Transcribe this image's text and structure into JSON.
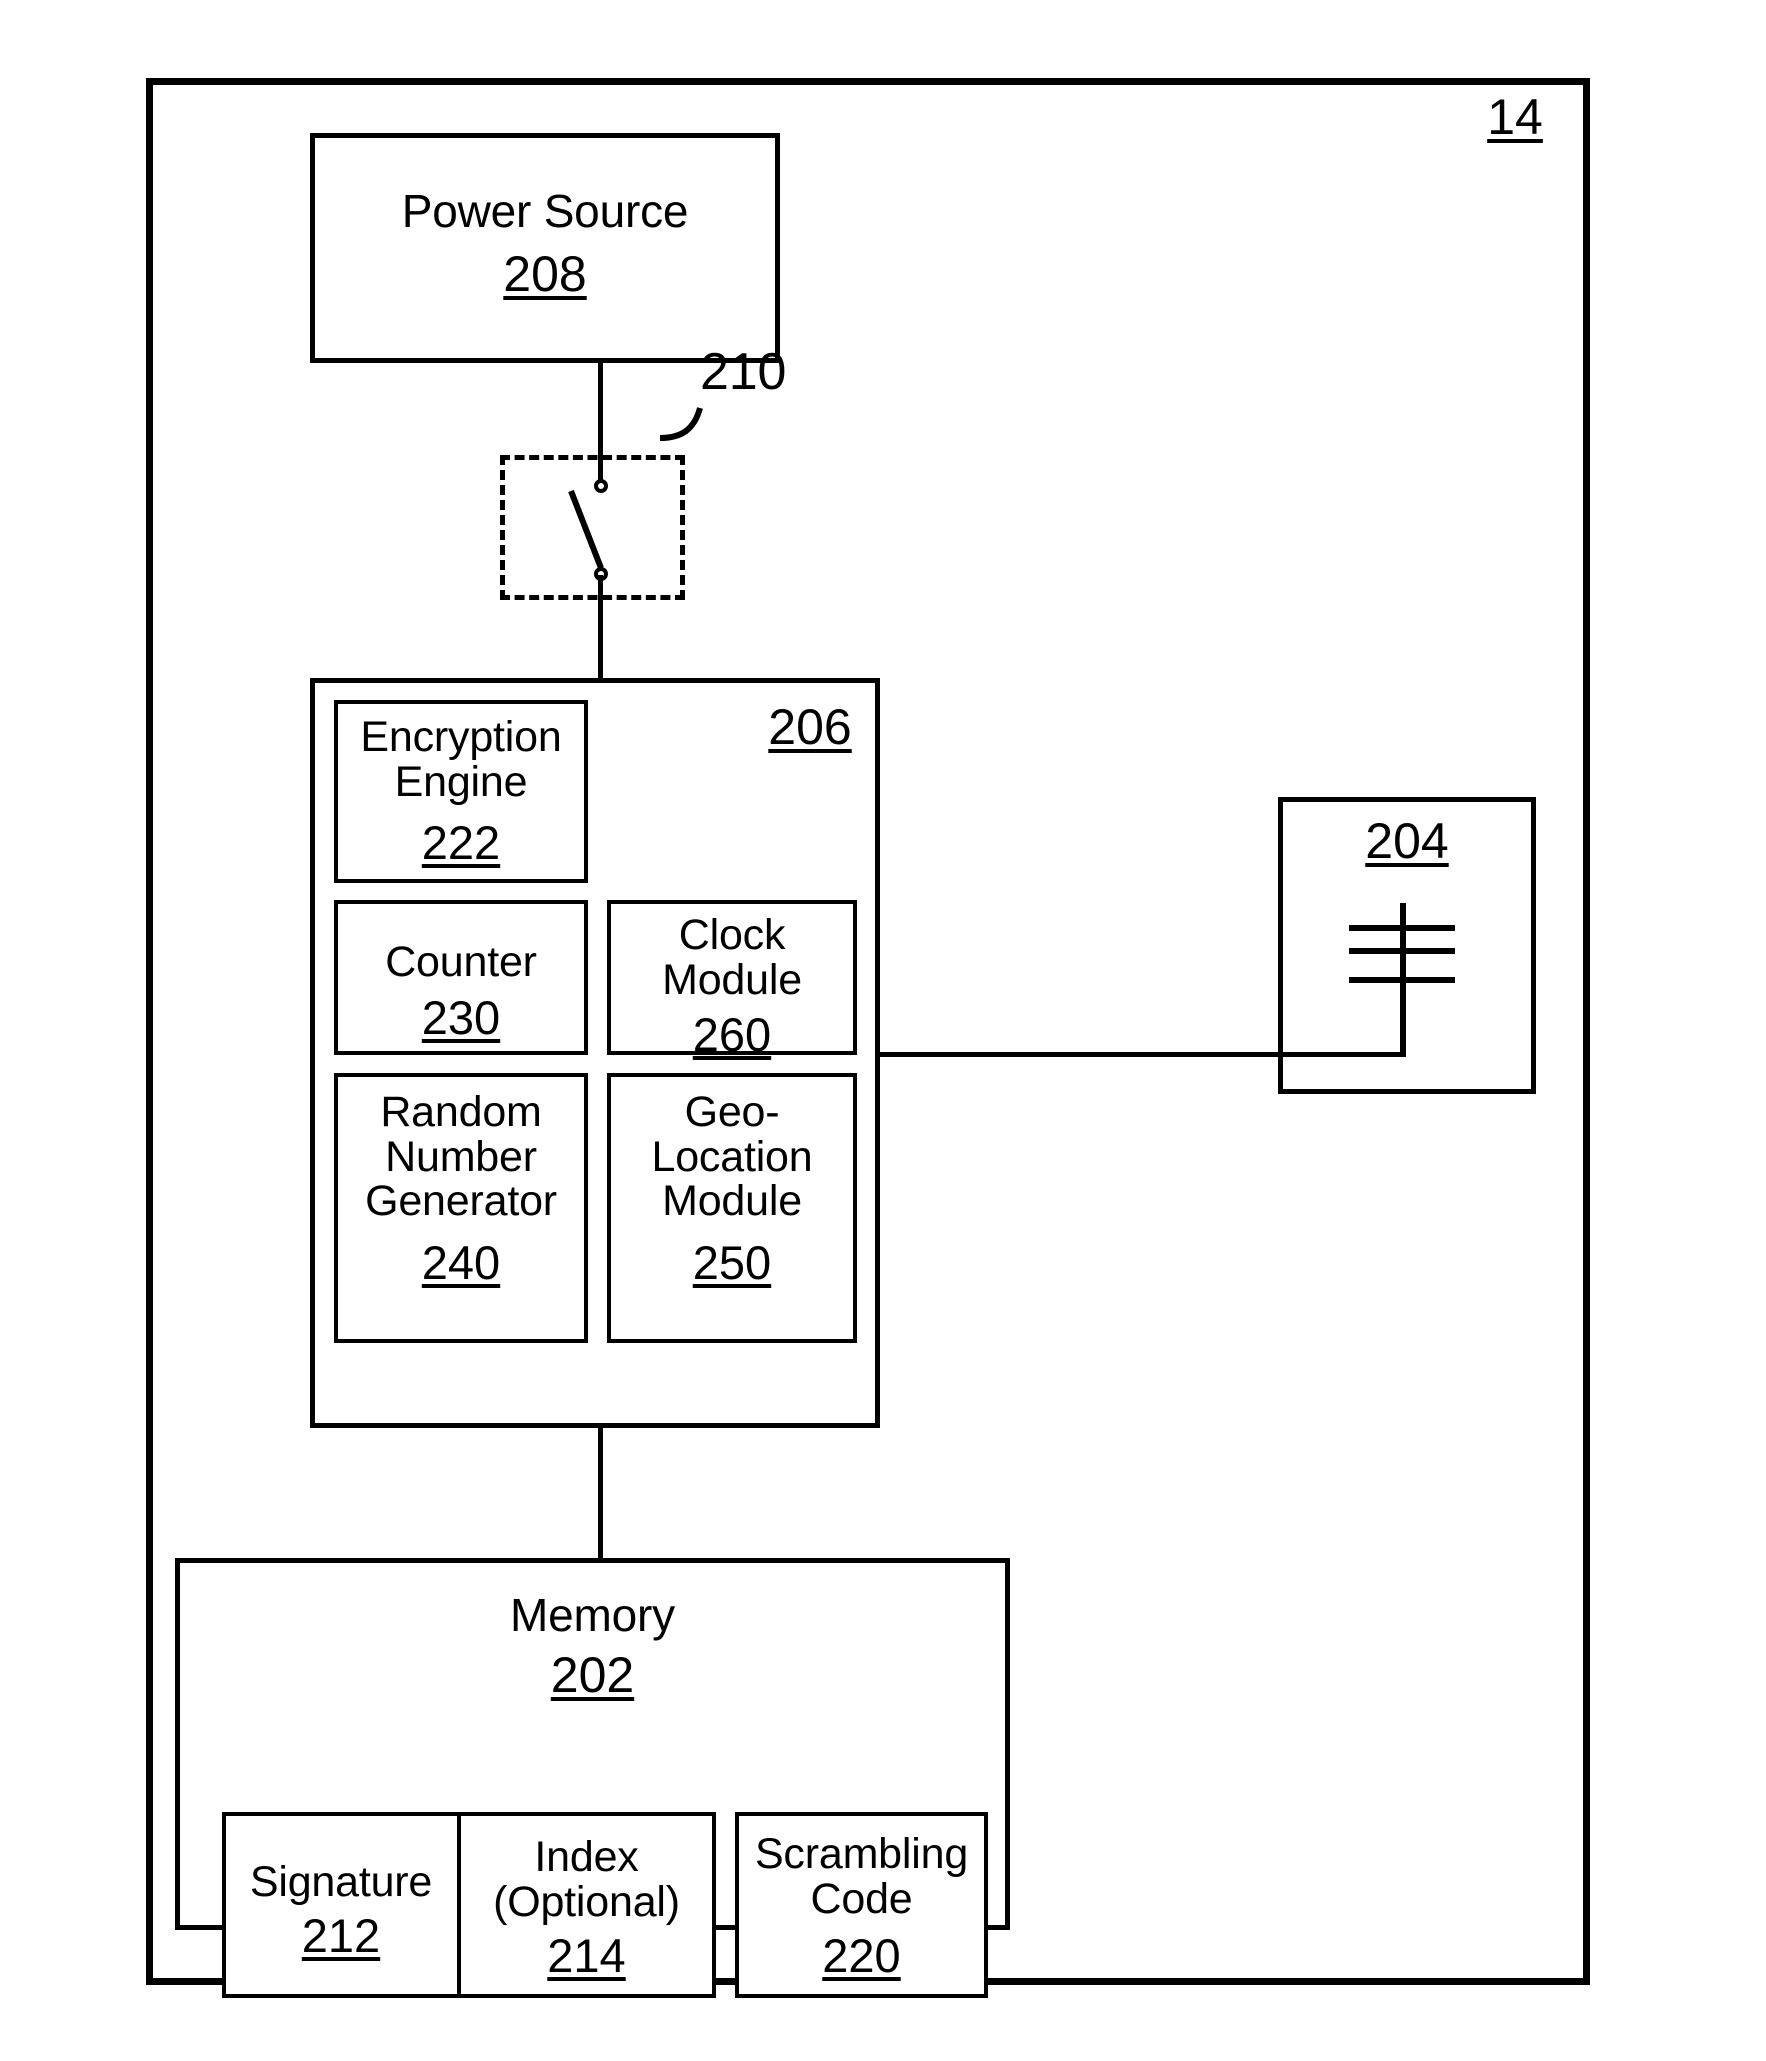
{
  "figure": {
    "reference_numeral": "14",
    "device_label": "14"
  },
  "blocks": {
    "power_source": {
      "title": "Power Source",
      "numeral": "208"
    },
    "switch": {
      "numeral": "210",
      "style": "dashed",
      "symbol": "spst-switch-icon"
    },
    "processor": {
      "numeral": "206",
      "children": {
        "encryption_engine": {
          "title": "Encryption\nEngine",
          "numeral": "222"
        },
        "counter": {
          "title": "Counter",
          "numeral": "230"
        },
        "clock_module": {
          "title": "Clock\nModule",
          "numeral": "260"
        },
        "random_number_generator": {
          "title": "Random\nNumber\nGenerator",
          "numeral": "240"
        },
        "geo_location_module": {
          "title": "Geo-\nLocation\nModule",
          "numeral": "250"
        }
      }
    },
    "antenna": {
      "numeral": "204",
      "symbol": "antenna-icon"
    },
    "memory": {
      "title": "Memory",
      "numeral": "202",
      "children": {
        "signature": {
          "title": "Signature",
          "numeral": "212"
        },
        "index": {
          "title": "Index\n(Optional)",
          "numeral": "214"
        },
        "scrambling_code": {
          "title": "Scrambling\nCode",
          "numeral": "220"
        }
      }
    }
  },
  "colors": {
    "line": "#000000",
    "background": "#ffffff"
  }
}
